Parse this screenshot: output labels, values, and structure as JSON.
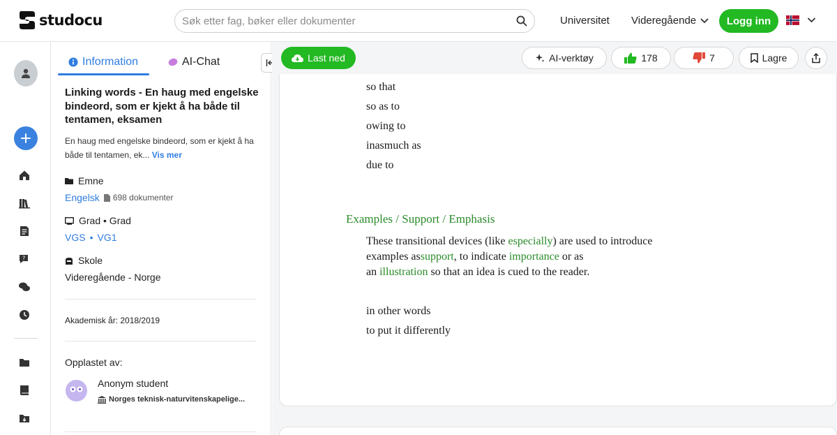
{
  "header": {
    "logo_text": "studocu",
    "search_placeholder": "Søk etter fag, bøker eller dokumenter",
    "nav_university": "Universitet",
    "nav_highschool": "Videregående",
    "login_label": "Logg inn",
    "brand_color": "#23b923"
  },
  "rail": {
    "items": [
      "user-avatar",
      "add-button",
      "home-icon",
      "library-icon",
      "notes-icon",
      "ai-question-icon",
      "chat-icon",
      "history-icon",
      "folder-icon",
      "book-icon",
      "download-folder-icon"
    ]
  },
  "panel": {
    "tab_info": "Information",
    "tab_ai": "AI-Chat",
    "doc_title": "Linking words - En haug med engelske bindeord, som er kjekt å ha både til tentamen, eksamen",
    "doc_desc": "En haug med engelske bindeord, som er kjekt å ha både til tentamen, ek...",
    "see_more": "Vis mer",
    "subject_label": "Emne",
    "subject_value": "Engelsk",
    "subject_count": "698 dokumenter",
    "grade_label": "Grad • Grad",
    "grade_value_1": "VGS",
    "grade_sep": "•",
    "grade_value_2": "VG1",
    "school_label": "Skole",
    "school_value": "Videregående - Norge",
    "academic_year": "Akademisk år: 2018/2019",
    "uploaded_by": "Opplastet av:",
    "uploader_name": "Anonym student",
    "uploader_school": "Norges teknisk-naturvitenskapelige..."
  },
  "toolbar": {
    "download": "Last ned",
    "ai_tools": "AI-verktøy",
    "likes": "178",
    "dislikes": "7",
    "save": "Lagre"
  },
  "document": {
    "lines_top": [
      "so that",
      "so as to",
      "owing to",
      "inasmuch as",
      "due to"
    ],
    "section_title": "Examples / Support / Emphasis",
    "para": {
      "l1_a": "These transitional devices (like ",
      "l1_b": "especially",
      "l1_c": ") are used to introduce",
      "l2_a": "examples as",
      "l2_b": "support",
      "l2_c": ", to indicate ",
      "l2_d": "importance",
      "l2_e": " or as",
      "l3_a": "an ",
      "l3_b": "illustration",
      "l3_c": " so that an idea is cued to the reader."
    },
    "lines_bottom": [
      "in other words",
      "to put it differently"
    ]
  }
}
